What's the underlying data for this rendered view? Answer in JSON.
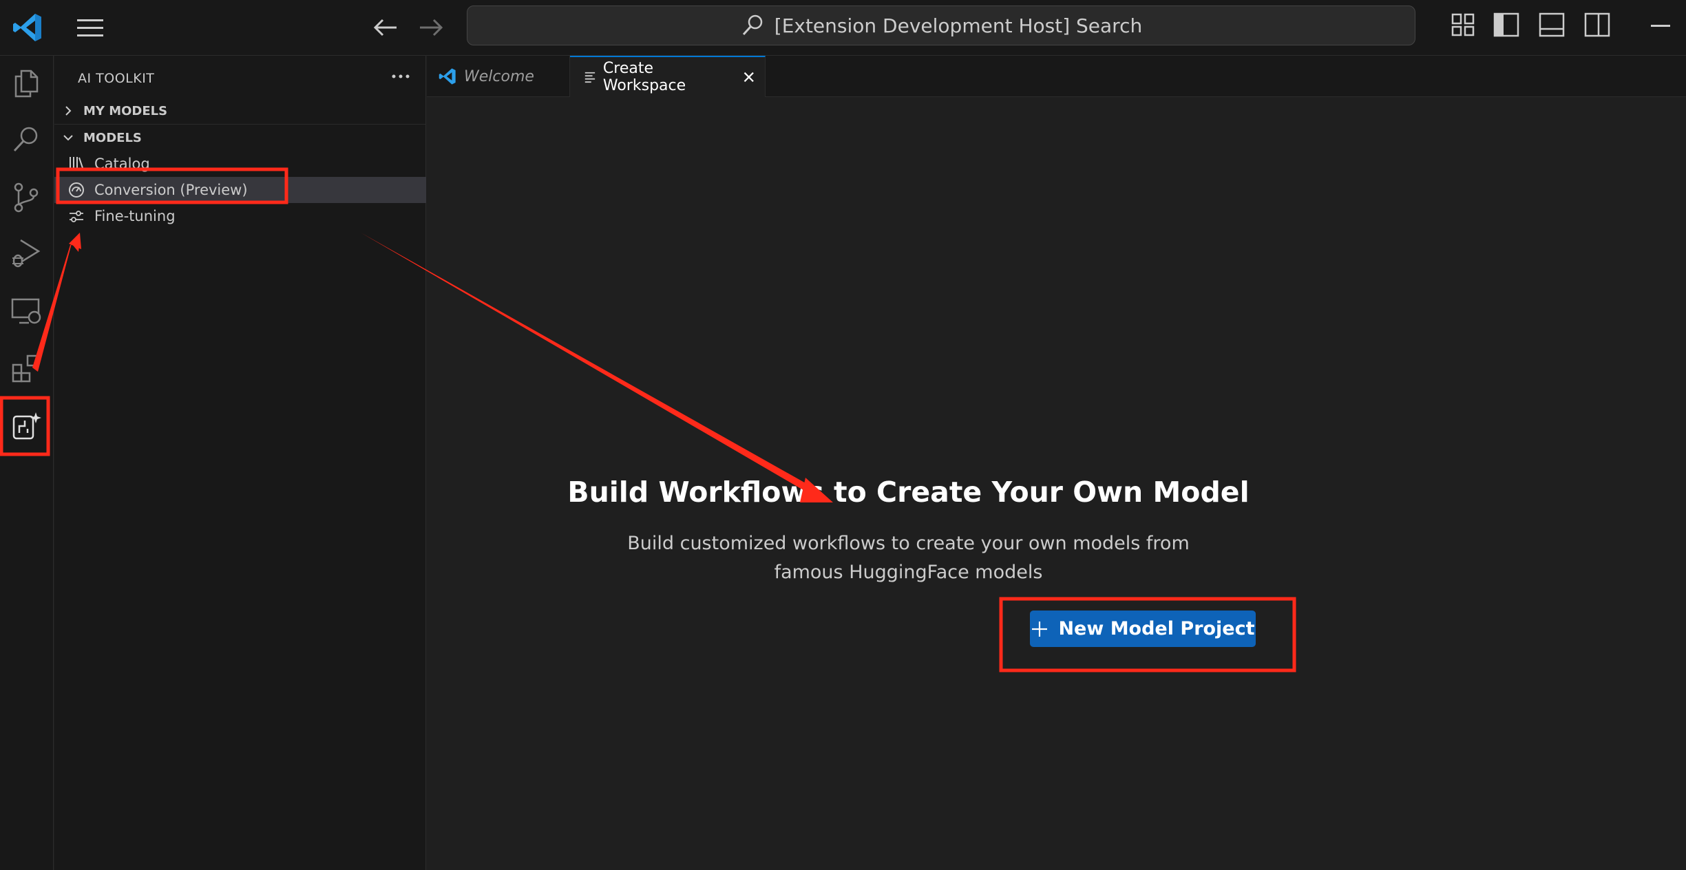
{
  "titlebar": {
    "search_text": "[Extension Development Host] Search"
  },
  "activitybar": {
    "items": [
      "explorer-icon",
      "search-icon",
      "source-control-icon",
      "run-debug-icon",
      "remote-explorer-icon",
      "extensions-icon",
      "ai-toolkit-icon"
    ]
  },
  "sidebar": {
    "title": "AI TOOLKIT",
    "sections": [
      {
        "label": "MY MODELS",
        "expanded": false
      },
      {
        "label": "MODELS",
        "expanded": true
      }
    ],
    "items": [
      {
        "label": "Catalog",
        "icon": "library-icon"
      },
      {
        "label": "Conversion (Preview)",
        "icon": "gauge-icon",
        "selected": true
      },
      {
        "label": "Fine-tuning",
        "icon": "sliders-icon"
      }
    ]
  },
  "tabs": [
    {
      "label": "Welcome",
      "active": false
    },
    {
      "label": "Create Workspace",
      "active": true
    }
  ],
  "editor": {
    "heading": "Build Workflows to Create Your Own Model",
    "subtext_line1": "Build customized workflows to create your own models from",
    "subtext_line2": "famous HuggingFace models",
    "button_label": "New Model Project"
  },
  "colors": {
    "accent": "#0078d4",
    "button": "#0e63b8",
    "annotation": "#ff2a1a"
  }
}
